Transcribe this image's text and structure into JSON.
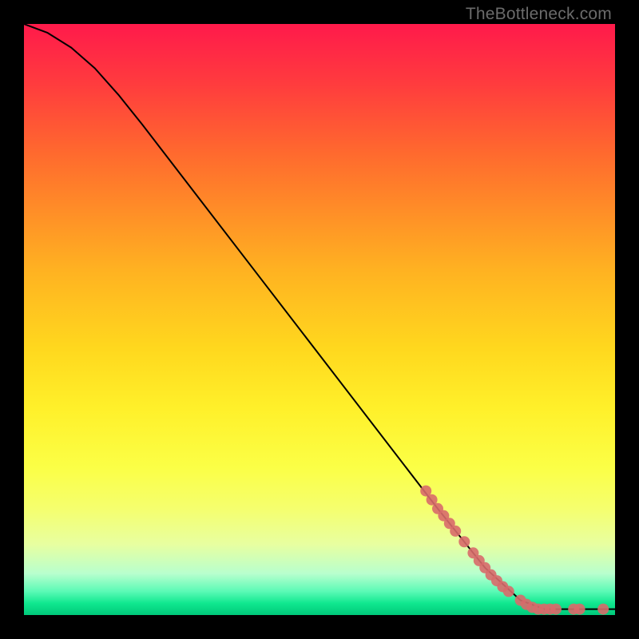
{
  "watermark": "TheBottleneck.com",
  "chart_data": {
    "type": "line",
    "title": "",
    "xlabel": "",
    "ylabel": "",
    "xlim": [
      0,
      100
    ],
    "ylim": [
      0,
      100
    ],
    "curve": {
      "name": "curve",
      "points": [
        {
          "x": 0,
          "y": 100
        },
        {
          "x": 4,
          "y": 98.5
        },
        {
          "x": 8,
          "y": 96
        },
        {
          "x": 12,
          "y": 92.5
        },
        {
          "x": 16,
          "y": 88
        },
        {
          "x": 20,
          "y": 83
        },
        {
          "x": 30,
          "y": 70
        },
        {
          "x": 40,
          "y": 57
        },
        {
          "x": 50,
          "y": 44
        },
        {
          "x": 60,
          "y": 31
        },
        {
          "x": 70,
          "y": 18
        },
        {
          "x": 78,
          "y": 8
        },
        {
          "x": 84,
          "y": 2.5
        },
        {
          "x": 88,
          "y": 1
        },
        {
          "x": 100,
          "y": 1
        }
      ]
    },
    "highlighted_points": {
      "name": "highlighted",
      "color": "#d86a6a",
      "points": [
        {
          "x": 68,
          "y": 21
        },
        {
          "x": 69,
          "y": 19.5
        },
        {
          "x": 70,
          "y": 18
        },
        {
          "x": 71,
          "y": 16.8
        },
        {
          "x": 72,
          "y": 15.5
        },
        {
          "x": 73,
          "y": 14.2
        },
        {
          "x": 74.5,
          "y": 12.4
        },
        {
          "x": 76,
          "y": 10.5
        },
        {
          "x": 77,
          "y": 9.2
        },
        {
          "x": 78,
          "y": 8
        },
        {
          "x": 79,
          "y": 6.8
        },
        {
          "x": 80,
          "y": 5.8
        },
        {
          "x": 81,
          "y": 4.8
        },
        {
          "x": 82,
          "y": 4
        },
        {
          "x": 84,
          "y": 2.5
        },
        {
          "x": 85,
          "y": 1.8
        },
        {
          "x": 86,
          "y": 1.3
        },
        {
          "x": 87,
          "y": 1
        },
        {
          "x": 88,
          "y": 1
        },
        {
          "x": 89,
          "y": 1
        },
        {
          "x": 90,
          "y": 1
        },
        {
          "x": 93,
          "y": 1
        },
        {
          "x": 94,
          "y": 1
        },
        {
          "x": 98,
          "y": 1
        }
      ]
    }
  }
}
